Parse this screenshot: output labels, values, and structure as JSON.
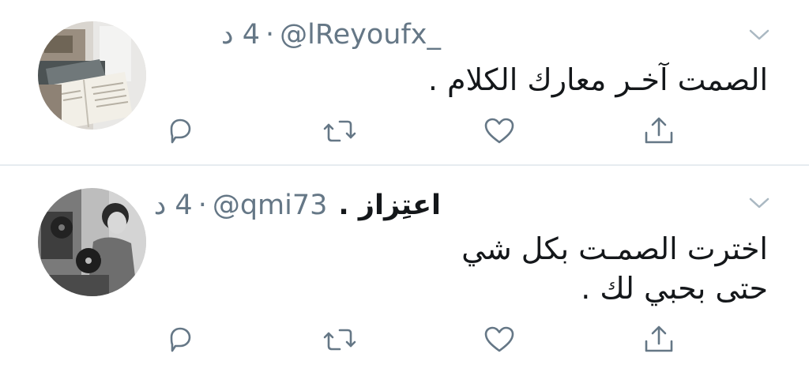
{
  "tweets": [
    {
      "display_name": "",
      "handle": "@lReyoufx_",
      "time": "4 د",
      "dot": "·",
      "lines": [
        "الصمت آخـر معارك الكلام ."
      ],
      "avatar_icon": "books-photo-avatar"
    },
    {
      "display_name": "اعتِزاز .",
      "handle": "@qmi73",
      "time": "4 د",
      "dot": "·",
      "lines": [
        "اخترت الصمـت بكل شي",
        "حتى بحبي لك ."
      ],
      "avatar_icon": "vintage-photo-avatar"
    }
  ],
  "actions": [
    "reply-icon",
    "retweet-icon",
    "like-icon",
    "share-icon"
  ],
  "colors": {
    "text": "#14171a",
    "secondary": "#657786",
    "icon": "#657786",
    "divider": "#e6ecf0",
    "chevron": "#aab8c2"
  }
}
